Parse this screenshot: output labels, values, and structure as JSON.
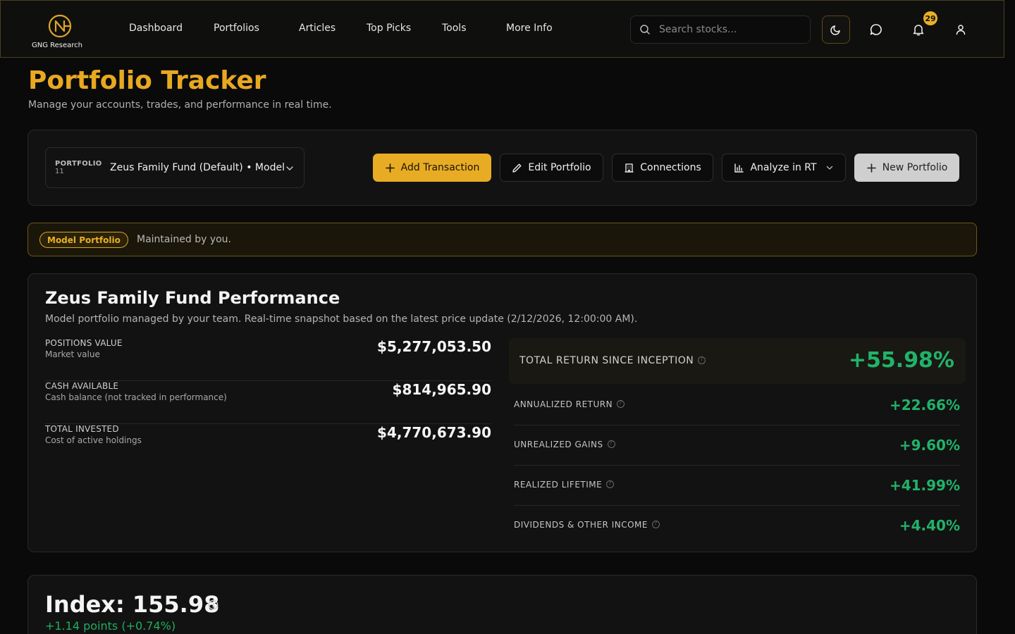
{
  "header": {
    "brand": "GNG Research",
    "nav": [
      "Dashboard",
      "Portfolios",
      "Articles",
      "Top Picks",
      "Tools",
      "More Info"
    ],
    "search_placeholder": "Search stocks...",
    "notification_count": "29",
    "icons": [
      "search-icon",
      "moon-icon",
      "chat-icon",
      "bell-icon",
      "user-icon"
    ]
  },
  "page": {
    "title": "Portfolio Tracker",
    "subtitle": "Manage your accounts, trades, and performance in real time."
  },
  "toolbar": {
    "portfolio_label": "PORTFOLIO",
    "portfolio_count": "11",
    "portfolio_selected": "Zeus Family Fund (Default) • Model",
    "add_transaction": "Add Transaction",
    "edit_portfolio": "Edit Portfolio",
    "connections": "Connections",
    "analyze": "Analyze in RT",
    "new_portfolio": "New Portfolio"
  },
  "banner": {
    "badge": "Model Portfolio",
    "text": "Maintained by you."
  },
  "performance": {
    "title": "Zeus Family Fund Performance",
    "subtitle": "Model portfolio managed by your team. Real-time snapshot based on the latest price update (2/12/2026, 12:00:00 AM).",
    "stats": [
      {
        "label": "POSITIONS VALUE",
        "desc": "Market value",
        "value": "$5,277,053.50"
      },
      {
        "label": "CASH AVAILABLE",
        "desc": "Cash balance (not tracked in performance)",
        "value": "$814,965.90"
      },
      {
        "label": "TOTAL INVESTED",
        "desc": "Cost of active holdings",
        "value": "$4,770,673.90"
      }
    ],
    "total_return_label": "TOTAL RETURN SINCE INCEPTION",
    "total_return_value": "+55.98%",
    "returns": [
      {
        "label": "ANNUALIZED RETURN",
        "value": "+22.66%"
      },
      {
        "label": "UNREALIZED GAINS",
        "value": "+9.60%"
      },
      {
        "label": "REALIZED LIFETIME",
        "value": "+41.99%"
      },
      {
        "label": "DIVIDENDS & OTHER INCOME",
        "value": "+4.40%"
      }
    ]
  },
  "index": {
    "title": "Index: 155.98",
    "change": "+1.14 points (+0.74%)"
  },
  "colors": {
    "accent": "#e8ac24",
    "positive": "#20b36a",
    "background": "#0a0a0a",
    "card": "#121212"
  }
}
